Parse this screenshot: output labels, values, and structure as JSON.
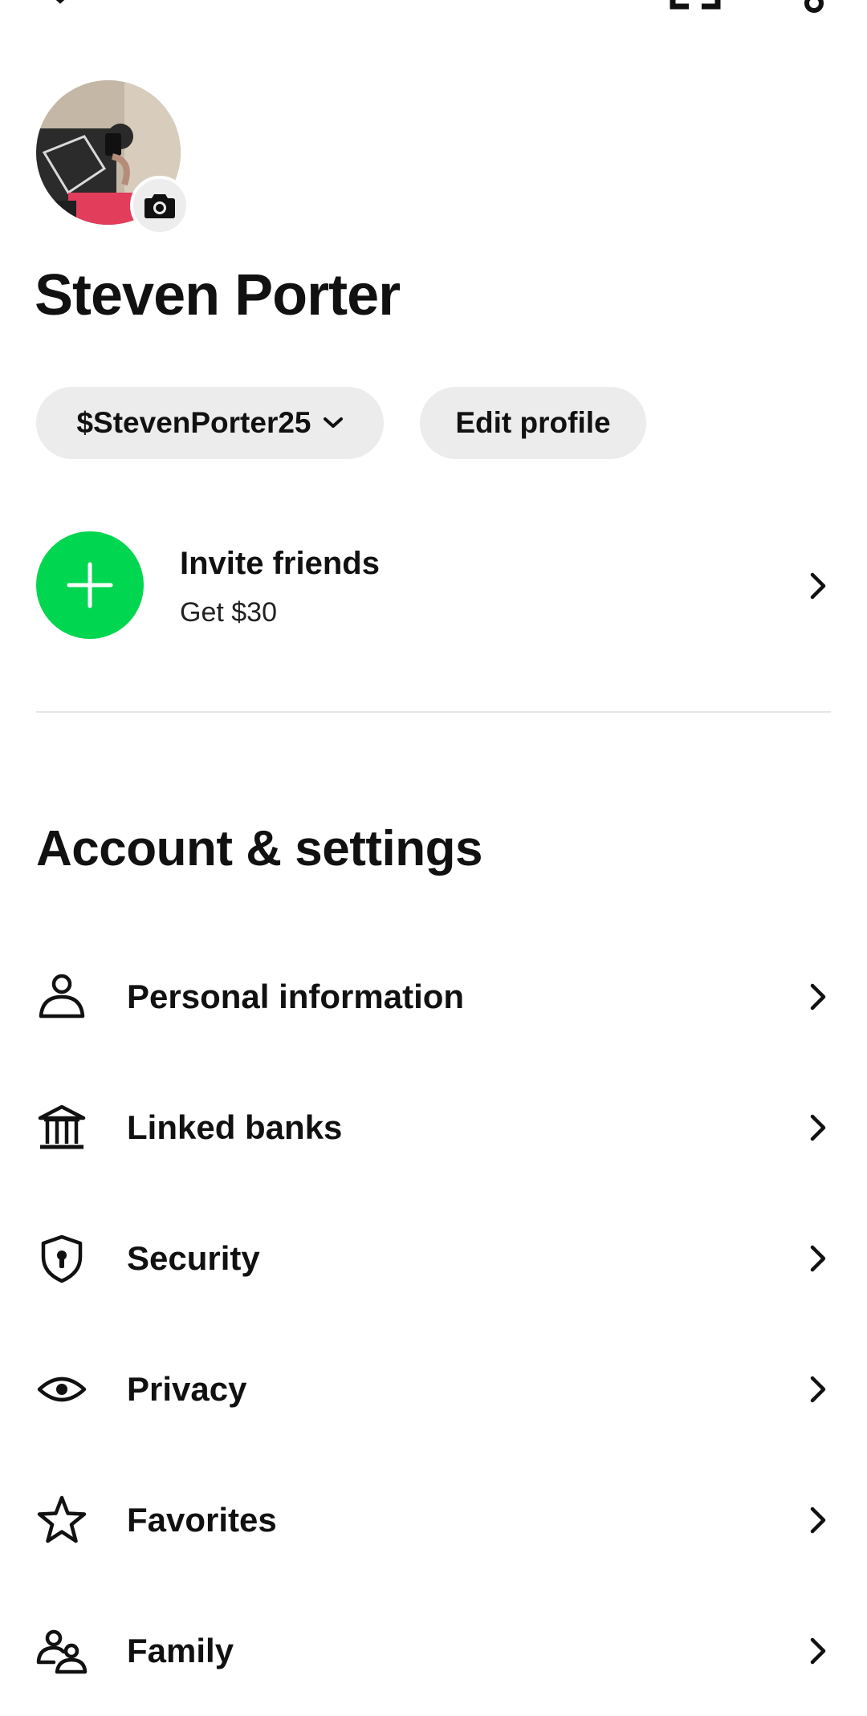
{
  "topbar": {
    "close_icon": "close-icon",
    "qr_icon": "qr-code-icon",
    "settings_icon": "settings-icon"
  },
  "profile": {
    "name": "Steven Porter",
    "cashtag": "$StevenPorter25",
    "edit_label": "Edit profile",
    "avatar_icon": "avatar-photo",
    "camera_icon": "camera-icon"
  },
  "invite": {
    "title": "Invite friends",
    "subtitle": "Get $30",
    "accent_color": "#00d64f"
  },
  "account_settings": {
    "title": "Account & settings",
    "items": [
      {
        "label": "Personal information",
        "icon": "person-icon"
      },
      {
        "label": "Linked banks",
        "icon": "bank-icon"
      },
      {
        "label": "Security",
        "icon": "shield-lock-icon"
      },
      {
        "label": "Privacy",
        "icon": "eye-icon"
      },
      {
        "label": "Favorites",
        "icon": "star-icon"
      },
      {
        "label": "Family",
        "icon": "family-icon"
      }
    ]
  }
}
